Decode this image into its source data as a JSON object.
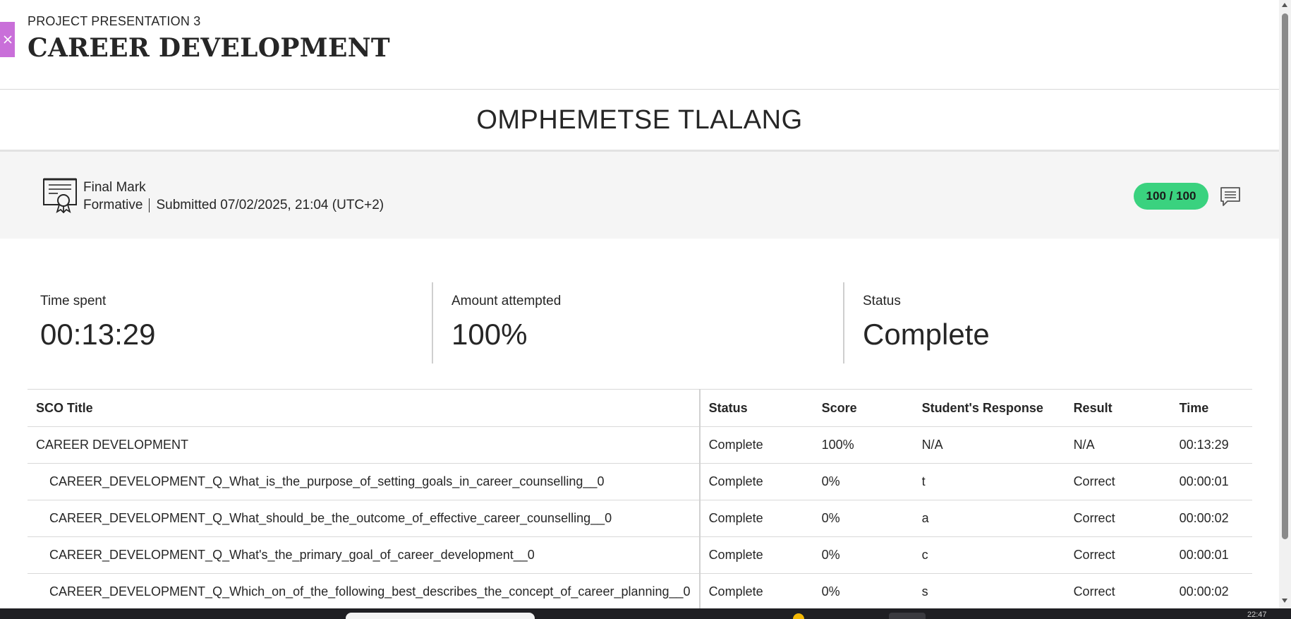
{
  "header": {
    "kicker": "PROJECT PRESENTATION 3",
    "title": "CAREER DEVELOPMENT"
  },
  "student": {
    "name": "OMPHEMETSE TLALANG"
  },
  "final_mark": {
    "title": "Final Mark",
    "type": "Formative",
    "submitted": "Submitted 07/02/2025, 21:04 (UTC+2)",
    "score": "100 / 100",
    "score_color": "#3ad27f"
  },
  "stats": [
    {
      "label": "Time spent",
      "value": "00:13:29"
    },
    {
      "label": "Amount attempted",
      "value": "100%"
    },
    {
      "label": "Status",
      "value": "Complete"
    }
  ],
  "table": {
    "headers": [
      "SCO Title",
      "Status",
      "Score",
      "Student's Response",
      "Result",
      "Time"
    ],
    "rows": [
      [
        "CAREER DEVELOPMENT",
        "Complete",
        "100%",
        "N/A",
        "N/A",
        "00:13:29"
      ],
      [
        "CAREER_DEVELOPMENT_Q_What_is_the_purpose_of_setting_goals_in_career_counselling__0",
        "Complete",
        "0%",
        "t",
        "Correct",
        "00:00:01"
      ],
      [
        "CAREER_DEVELOPMENT_Q_What_should_be_the_outcome_of_effective_career_counselling__0",
        "Complete",
        "0%",
        "a",
        "Correct",
        "00:00:02"
      ],
      [
        "CAREER_DEVELOPMENT_Q_What's_the_primary_goal_of_career_development__0",
        "Complete",
        "0%",
        "c",
        "Correct",
        "00:00:01"
      ],
      [
        "CAREER_DEVELOPMENT_Q_Which_on_of_the_following_best_describes_the_concept_of_career_planning__0",
        "Complete",
        "0%",
        "s",
        "Correct",
        "00:00:02"
      ]
    ]
  },
  "icons": {
    "close": "close-icon",
    "certificate": "certificate-icon",
    "comment": "comment-icon"
  },
  "taskbar": {
    "clock": "22:47"
  }
}
